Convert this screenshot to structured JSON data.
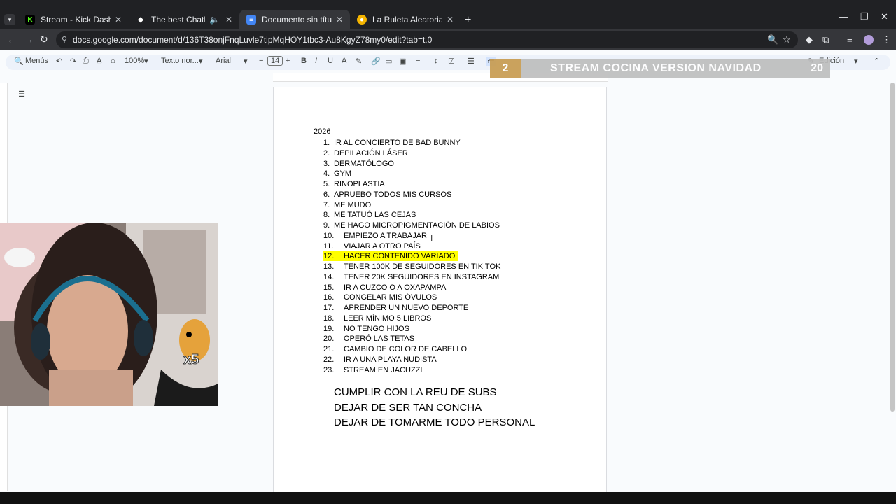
{
  "tabs": [
    {
      "title": "Stream - Kick Dashboard",
      "icon": "kick-icon",
      "color": "#53fc18"
    },
    {
      "title": "The best ChatBot and Widg",
      "icon": "botrix-icon",
      "color": "#ffffff"
    },
    {
      "title": "Documento sin título - Docum",
      "icon": "google-docs-icon",
      "color": "#4285f4"
    },
    {
      "title": "La Ruleta Aleatoria",
      "icon": "wheel-icon",
      "color": "#f4b400"
    }
  ],
  "address": {
    "url": "docs.google.com/document/d/136T38onjFnqLuvle7tipMqHOY1tbc3-Au8KgyZ78my0/edit?tab=t.0"
  },
  "toolbar": {
    "menus": "Menús",
    "zoom": "100%",
    "style": "Texto nor...",
    "font": "Arial",
    "font_size": "14",
    "mode": "Edición"
  },
  "banner": {
    "number": "2",
    "text": "STREAM COCINA VERSION NAVIDAD",
    "count": "20"
  },
  "webcam": {
    "overlay": "x5"
  },
  "document": {
    "year": "2026",
    "items": [
      {
        "n": "1.",
        "text": "IR AL CONCIERTO DE BAD BUNNY"
      },
      {
        "n": "2.",
        "text": "DEPILACIÓN LÁSER"
      },
      {
        "n": "3.",
        "text": "DERMATÓLOGO"
      },
      {
        "n": "4.",
        "text": "GYM"
      },
      {
        "n": "5.",
        "text": "RINOPLASTIA"
      },
      {
        "n": "6.",
        "text": "APRUEBO TODOS MIS CURSOS"
      },
      {
        "n": "7.",
        "text": "ME MUDO"
      },
      {
        "n": "8.",
        "text": "ME TATUÓ LAS CEJAS"
      },
      {
        "n": "9.",
        "text": "ME HAGO MICROPIGMENTACIÓN DE LABIOS"
      },
      {
        "n": "10.",
        "text": "EMPIEZO A TRABAJAR"
      },
      {
        "n": "11.",
        "text": "VIAJAR A OTRO PAÍS"
      },
      {
        "n": "12.",
        "text": "HACER CONTENIDO VARIADO"
      },
      {
        "n": "13.",
        "text": "TENER 100K DE SEGUIDORES EN TIK TOK"
      },
      {
        "n": "14.",
        "text": "TENER 20K SEGUIDORES EN INSTAGRAM"
      },
      {
        "n": "15.",
        "text": "IR A CUZCO O A OXAPAMPA"
      },
      {
        "n": "16.",
        "text": "CONGELAR MIS ÓVULOS"
      },
      {
        "n": "17.",
        "text": "APRENDER UN NUEVO DEPORTE"
      },
      {
        "n": "18.",
        "text": "LEER MÍNIMO 5 LIBROS"
      },
      {
        "n": "19.",
        "text": "NO TENGO HIJOS"
      },
      {
        "n": "20.",
        "text": "OPERÓ LAS TETAS"
      },
      {
        "n": "21.",
        "text": "CAMBIO DE COLOR DE CABELLO"
      },
      {
        "n": "22.",
        "text": "IR A UNA PLAYA NUDISTA"
      },
      {
        "n": "23.",
        "text": "STREAM EN JACUZZI"
      }
    ],
    "highlight_color": "#ffff00",
    "extra": [
      "CUMPLIR CON LA REU DE SUBS",
      "DEJAR DE SER TAN CONCHA",
      "DEJAR DE TOMARME TODO PERSONAL"
    ]
  }
}
